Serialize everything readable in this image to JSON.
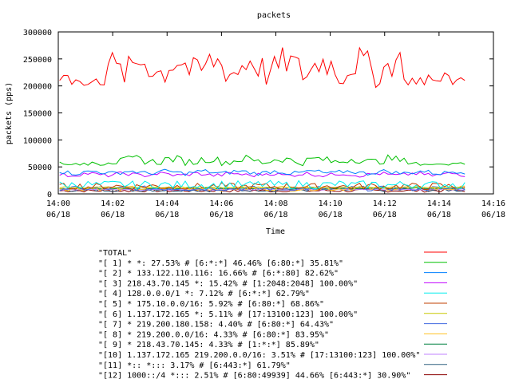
{
  "chart_data": {
    "type": "line",
    "title": "packets",
    "xlabel": "Time",
    "ylabel": "packets (pps)",
    "ylim": [
      0,
      300000
    ],
    "yticks": [
      0,
      50000,
      100000,
      150000,
      200000,
      250000,
      300000
    ],
    "xlim": [
      "14:00",
      "14:16"
    ],
    "xticks": [
      {
        "time": "14:00",
        "date": "06/18"
      },
      {
        "time": "14:02",
        "date": "06/18"
      },
      {
        "time": "14:04",
        "date": "06/18"
      },
      {
        "time": "14:06",
        "date": "06/18"
      },
      {
        "time": "14:08",
        "date": "06/18"
      },
      {
        "time": "14:10",
        "date": "06/18"
      },
      {
        "time": "14:12",
        "date": "06/18"
      },
      {
        "time": "14:14",
        "date": "06/18"
      },
      {
        "time": "14:16",
        "date": "06/18"
      }
    ],
    "grid": false,
    "legend_position": "bottom",
    "series": [
      {
        "name": "\"TOTAL\"",
        "color": "#ff0000",
        "shape": "total",
        "mean": 235000
      },
      {
        "name": "\"[ 1] * *: 27.53% # [6:*:*] 46.46% [6:80:*] 35.81%\"",
        "color": "#00c000",
        "shape": "total",
        "mean": 62000
      },
      {
        "name": "\"[ 2] * 133.122.110.116: 16.66% # [6:*:80] 82.62%\"",
        "color": "#0080ff",
        "shape": "flat",
        "mean": 40000
      },
      {
        "name": "\"[ 3] 218.43.70.145 *: 15.42% # [1:2048:2048] 100.00%\"",
        "color": "#c000ff",
        "shape": "flat",
        "mean": 36000
      },
      {
        "name": "\"[ 4] 128.0.0.0/1 *: 7.12% # [6:*:*] 62.79%\"",
        "color": "#00eeee",
        "shape": "noisy",
        "mean": 17000
      },
      {
        "name": "\"[ 5] * 175.10.0.0/16: 5.92% # [6:80:*] 68.86%\"",
        "color": "#c04000",
        "shape": "noisy",
        "mean": 14000
      },
      {
        "name": "\"[ 6] 1.137.172.165 *: 5.11% # [17:13100:123] 100.00%\"",
        "color": "#c8c800",
        "shape": "flat",
        "mean": 12000
      },
      {
        "name": "\"[ 7] * 219.200.180.158: 4.40% # [6:80:*] 64.43%\"",
        "color": "#4169e1",
        "shape": "noisy",
        "mean": 10000
      },
      {
        "name": "\"[ 8] * 219.200.0.0/16: 4.33% # [6:80:*] 83.95%\"",
        "color": "#ffc020",
        "shape": "noisy",
        "mean": 10000
      },
      {
        "name": "\"[ 9] * 218.43.70.145: 4.33% # [1:*:*] 85.89%\"",
        "color": "#008040",
        "shape": "flat",
        "mean": 10000
      },
      {
        "name": "\"[10] 1.137.172.165 219.200.0.0/16: 3.51% # [17:13100:123] 100.00%\"",
        "color": "#c080ff",
        "shape": "flat",
        "mean": 8000
      },
      {
        "name": "\"[11] *:: *::: 3.17% # [6:443:*] 61.79%\"",
        "color": "#306080",
        "shape": "noisy",
        "mean": 7500
      },
      {
        "name": "\"[12] 1000::/4 *::: 2.51% # [6:80:49939] 44.66% [6:443:*] 30.90%\"",
        "color": "#8b0000",
        "shape": "noisy",
        "mean": 6000
      }
    ]
  }
}
